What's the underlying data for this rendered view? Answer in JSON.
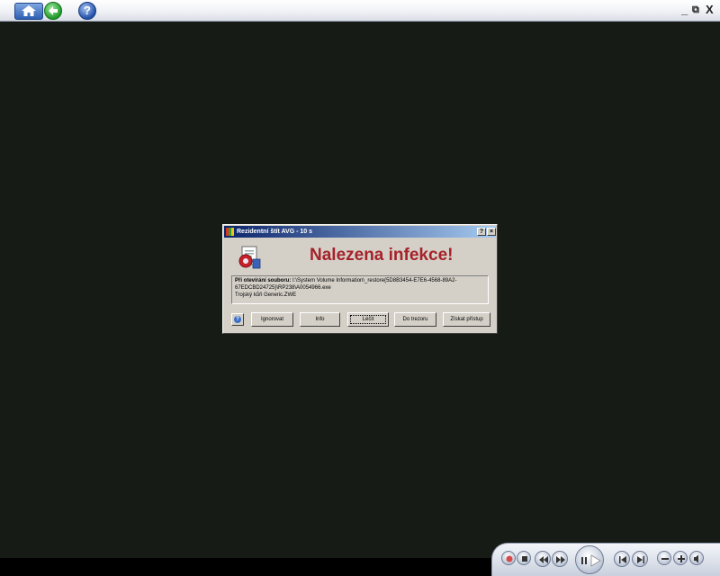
{
  "toolbar": {
    "home_icon": "home-icon",
    "back_icon": "back-arrow-icon",
    "help_label": "?",
    "minimize_label": "_",
    "restore_label": "⧉",
    "close_label": "X"
  },
  "dialog": {
    "title": "Rezidentní štít AVG - 10 s",
    "help_title_label": "?",
    "close_title_label": "×",
    "headline": "Nalezena infekce!",
    "file_label": "Při otevírání souboru:",
    "file_path": "I:\\System Volume Information\\_restore{5D8B3454-E7E6-4568-89A2-67EDCBD24725}\\RP238\\A0054966.exe",
    "threat": "Trojský kůň Generic.ZWE",
    "buttons": {
      "help": "?",
      "ignore": "Ignorovat",
      "info": "Info",
      "heal": "Léčit",
      "vault": "Do trezoru",
      "access": "Získat přístup"
    },
    "accent_color": "#a5222a"
  },
  "player": {
    "icons": [
      "record-icon",
      "stop-icon",
      "rewind-icon",
      "fast-forward-icon",
      "pause-icon",
      "play-icon",
      "previous-icon",
      "next-icon",
      "volume-down-icon",
      "volume-up-icon",
      "mute-icon"
    ]
  }
}
